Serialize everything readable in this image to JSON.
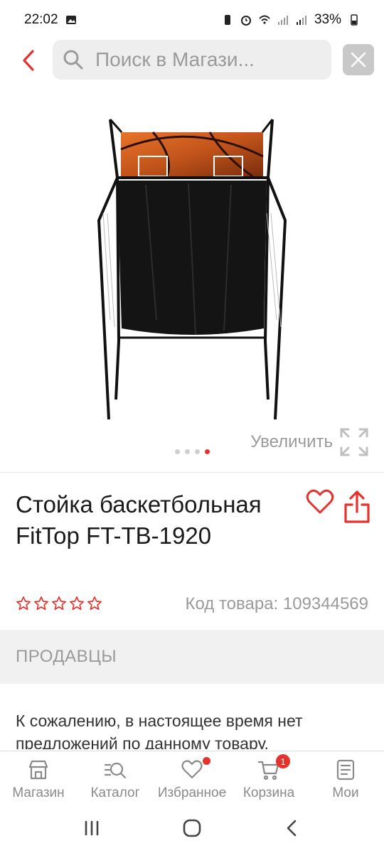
{
  "status": {
    "time": "22:02",
    "battery": "33%"
  },
  "search": {
    "placeholder": "Поиск в Магази..."
  },
  "gallery": {
    "zoom_label": "Увеличить",
    "pages": 4,
    "active_page": 4
  },
  "product": {
    "title": "Стойка баскетбольная FitTop FT-TB-1920",
    "sku_label": "Код товара: 109344569",
    "rating": 0,
    "rating_max": 5
  },
  "sellers": {
    "heading": "ПРОДАВЦЫ",
    "no_offers": "К сожалению, в настоящее время нет предложений по данному товару."
  },
  "nav": {
    "items": [
      {
        "label": "Магазин",
        "icon": "store-icon"
      },
      {
        "label": "Каталог",
        "icon": "catalog-search-icon"
      },
      {
        "label": "Избранное",
        "icon": "heart-icon"
      },
      {
        "label": "Корзина",
        "icon": "cart-icon",
        "badge": "1"
      },
      {
        "label": "Мои",
        "icon": "orders-icon"
      }
    ]
  },
  "colors": {
    "accent": "#e5322d",
    "muted": "#9a9a9a"
  }
}
